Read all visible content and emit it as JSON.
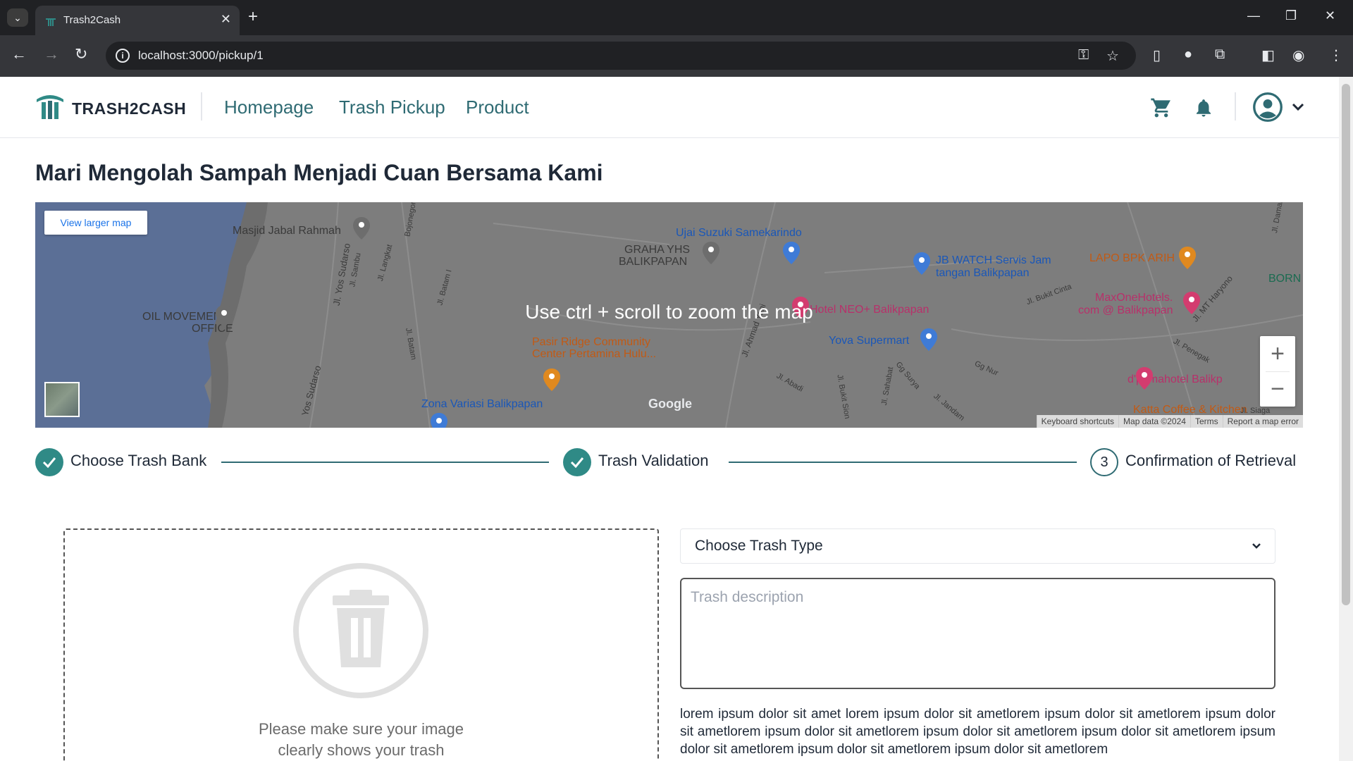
{
  "browser": {
    "tab_title": "Trash2Cash",
    "url": "localhost:3000/pickup/1"
  },
  "header": {
    "logo_text": "TRASH2CASH",
    "nav": [
      "Homepage",
      "Trash Pickup",
      "Product"
    ]
  },
  "hero": {
    "title": "Mari Mengolah Sampah Menjadi Cuan Bersama Kami"
  },
  "map": {
    "view_larger_label": "View larger map",
    "overlay_text": "Use ctrl + scroll to zoom the map",
    "zoom_in": "+",
    "zoom_out": "−",
    "google": "Google",
    "footer": [
      "Keyboard shortcuts",
      "Map data ©2024",
      "Terms",
      "Report a map error"
    ],
    "labels": [
      "Masjid Jabal Rahmah",
      "Ujai Suzuki Samekarindo",
      "GRAHA YHS",
      "BALIKPAPAN",
      "JB WATCH Servis Jam",
      "tangan Balikpapan",
      "LAPO BPK ARIH",
      "BORN",
      "OIL MOVEMENT",
      "OFFICE",
      "Hotel NEO+ Balikpapan",
      "MaxOneHotels.",
      "com @ Balikpapan",
      "Yova Supermart",
      "Pasir Ridge Community",
      "Center Pertamina Hulu...",
      "Zona Variasi Balikpapan",
      "d'primahotel Balikp",
      "Katta Coffee & Kitchen",
      "Jl. Yos Sudarso",
      "Jl. Sambu",
      "Jl. Langkat",
      "Bojonegoro",
      "Jl. Batam I",
      "Jl. Batam",
      "Jl. Ahmad Yani",
      "Jl. Abadi",
      "Jl. Bukit Sion",
      "Jl. Sahabat",
      "Gg Surya",
      "Jl. Jandam",
      "Gg Nur",
      "Jl. Bukit Cinta",
      "Jl. MT Haryono",
      "Jl. Penegak",
      "Yos Sudarso",
      "Jl. Damai",
      "Jl. Siaga"
    ]
  },
  "stepper": {
    "steps": [
      {
        "label": "Choose Trash Bank",
        "status": "done"
      },
      {
        "label": "Trash Validation",
        "status": "done"
      },
      {
        "label": "Confirmation of Retrieval",
        "status": "pending",
        "number": "3"
      }
    ]
  },
  "form": {
    "upload_hint_line1": "Please make sure your image",
    "upload_hint_line2": "clearly shows your trash",
    "trash_type_selected": "Choose Trash Type",
    "description_placeholder": "Trash description",
    "lorem": "lorem ipsum dolor sit amet lorem ipsum dolor sit ametlorem ipsum dolor sit ametlorem ipsum dolor sit ametlorem ipsum dolor sit ametlorem ipsum dolor sit ametlorem ipsum dolor sit ametlorem ipsum dolor sit ametlorem ipsum dolor sit ametlorem ipsum dolor sit ametlorem"
  },
  "colors": {
    "accent": "#2f6b73",
    "step_done": "#2f8a86",
    "chrome_dark": "#202124"
  }
}
